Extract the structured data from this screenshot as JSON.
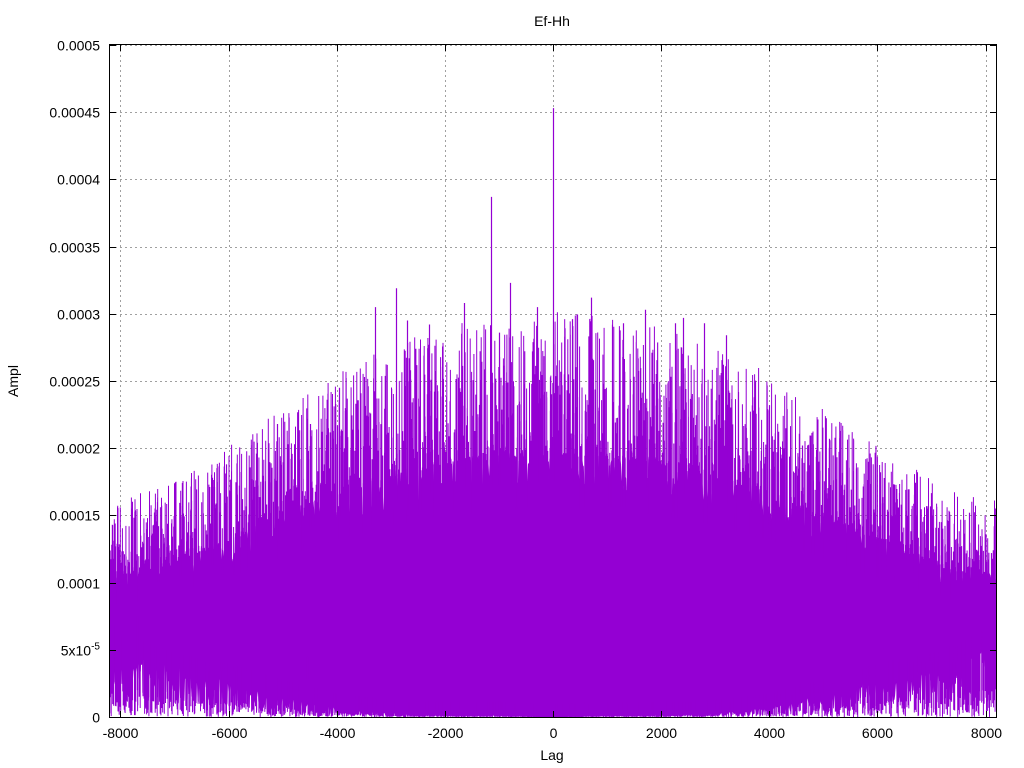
{
  "chart_data": {
    "type": "area",
    "title": "Ef-Hh",
    "xlabel": "Lag",
    "ylabel": "Ampl",
    "xlim": [
      -8192,
      8192
    ],
    "ylim": [
      0,
      0.0005
    ],
    "grid": true,
    "legend": "none",
    "x_ticks": [
      {
        "value": -8000,
        "label": "-8000"
      },
      {
        "value": -6000,
        "label": "-6000"
      },
      {
        "value": -4000,
        "label": "-4000"
      },
      {
        "value": -2000,
        "label": "-2000"
      },
      {
        "value": 0,
        "label": "0"
      },
      {
        "value": 2000,
        "label": "2000"
      },
      {
        "value": 4000,
        "label": "4000"
      },
      {
        "value": 6000,
        "label": "6000"
      },
      {
        "value": 8000,
        "label": "8000"
      }
    ],
    "y_ticks": [
      {
        "value": 0,
        "label": "0"
      },
      {
        "value": 5e-05,
        "label": "5x10",
        "sup": "-5"
      },
      {
        "value": 0.0001,
        "label": "0.0001"
      },
      {
        "value": 0.00015,
        "label": "0.00015"
      },
      {
        "value": 0.0002,
        "label": "0.0002"
      },
      {
        "value": 0.00025,
        "label": "0.00025"
      },
      {
        "value": 0.0003,
        "label": "0.0003"
      },
      {
        "value": 0.00035,
        "label": "0.00035"
      },
      {
        "value": 0.0004,
        "label": "0.0004"
      },
      {
        "value": 0.00045,
        "label": "0.00045"
      },
      {
        "value": 0.0005,
        "label": "0.0005"
      }
    ],
    "series": [
      {
        "color": "#9400d3",
        "envelope": {
          "x": [
            -8192,
            -7500,
            -7000,
            -6000,
            -5000,
            -4000,
            -3000,
            -2000,
            -1000,
            0,
            1000,
            2000,
            3000,
            4000,
            5000,
            6000,
            7000,
            7500,
            8192
          ],
          "typical_max": [
            0.000105,
            0.000108,
            0.000115,
            0.00013,
            0.000148,
            0.000165,
            0.000178,
            0.000188,
            0.000192,
            0.000195,
            0.000192,
            0.000188,
            0.000178,
            0.000165,
            0.000148,
            0.00013,
            0.000115,
            0.000108,
            0.000105
          ],
          "typical_min": [
            4e-05,
            3e-05,
            2.5e-05,
            2e-05,
            1.2e-05,
            5e-06,
            2e-06,
            1e-06,
            1e-06,
            0.0,
            1e-06,
            1e-06,
            2e-06,
            5e-06,
            1.2e-05,
            2e-05,
            2.5e-05,
            3e-05,
            4e-05
          ]
        },
        "peaks": [
          {
            "x": -8100,
            "y": 0.000127
          },
          {
            "x": -7300,
            "y": 0.000142
          },
          {
            "x": -6900,
            "y": 0.000157
          },
          {
            "x": -6300,
            "y": 0.000178
          },
          {
            "x": -6050,
            "y": 0.000188
          },
          {
            "x": -5500,
            "y": 0.000196
          },
          {
            "x": -5100,
            "y": 0.000218
          },
          {
            "x": -4500,
            "y": 0.000218
          },
          {
            "x": -4000,
            "y": 0.000217
          },
          {
            "x": -3960,
            "y": 0.000245
          },
          {
            "x": -3500,
            "y": 0.000253
          },
          {
            "x": -3300,
            "y": 0.000305
          },
          {
            "x": -2900,
            "y": 0.000319
          },
          {
            "x": -2700,
            "y": 0.000295
          },
          {
            "x": -2300,
            "y": 0.000292
          },
          {
            "x": -1650,
            "y": 0.000308
          },
          {
            "x": -1150,
            "y": 0.000387
          },
          {
            "x": -1000,
            "y": 0.000286
          },
          {
            "x": -800,
            "y": 0.000323
          },
          {
            "x": -300,
            "y": 0.000305
          },
          {
            "x": 0,
            "y": 0.000453
          },
          {
            "x": 350,
            "y": 0.000296
          },
          {
            "x": 700,
            "y": 0.000312
          },
          {
            "x": 1300,
            "y": 0.000293
          },
          {
            "x": 1700,
            "y": 0.000303
          },
          {
            "x": 2250,
            "y": 0.000293
          },
          {
            "x": 2400,
            "y": 0.000297
          },
          {
            "x": 2800,
            "y": 0.000293
          },
          {
            "x": 3200,
            "y": 0.000284
          },
          {
            "x": 3700,
            "y": 0.000228
          },
          {
            "x": 4000,
            "y": 0.000232
          },
          {
            "x": 4600,
            "y": 0.000202
          },
          {
            "x": 5100,
            "y": 0.000207
          },
          {
            "x": 5600,
            "y": 0.000185
          },
          {
            "x": 6300,
            "y": 0.000173
          },
          {
            "x": 7000,
            "y": 0.00015
          },
          {
            "x": 7700,
            "y": 0.000152
          },
          {
            "x": 8100,
            "y": 0.000122
          }
        ],
        "dips": [
          {
            "x": -7700,
            "y": 2e-05
          },
          {
            "x": -4550,
            "y": 4.5e-05
          },
          {
            "x": -1000,
            "y": 0.0
          },
          {
            "x": 0,
            "y": 0.0
          },
          {
            "x": 2000,
            "y": 0.0
          },
          {
            "x": 6100,
            "y": 4e-05
          },
          {
            "x": 7200,
            "y": 3e-05
          }
        ]
      }
    ]
  }
}
